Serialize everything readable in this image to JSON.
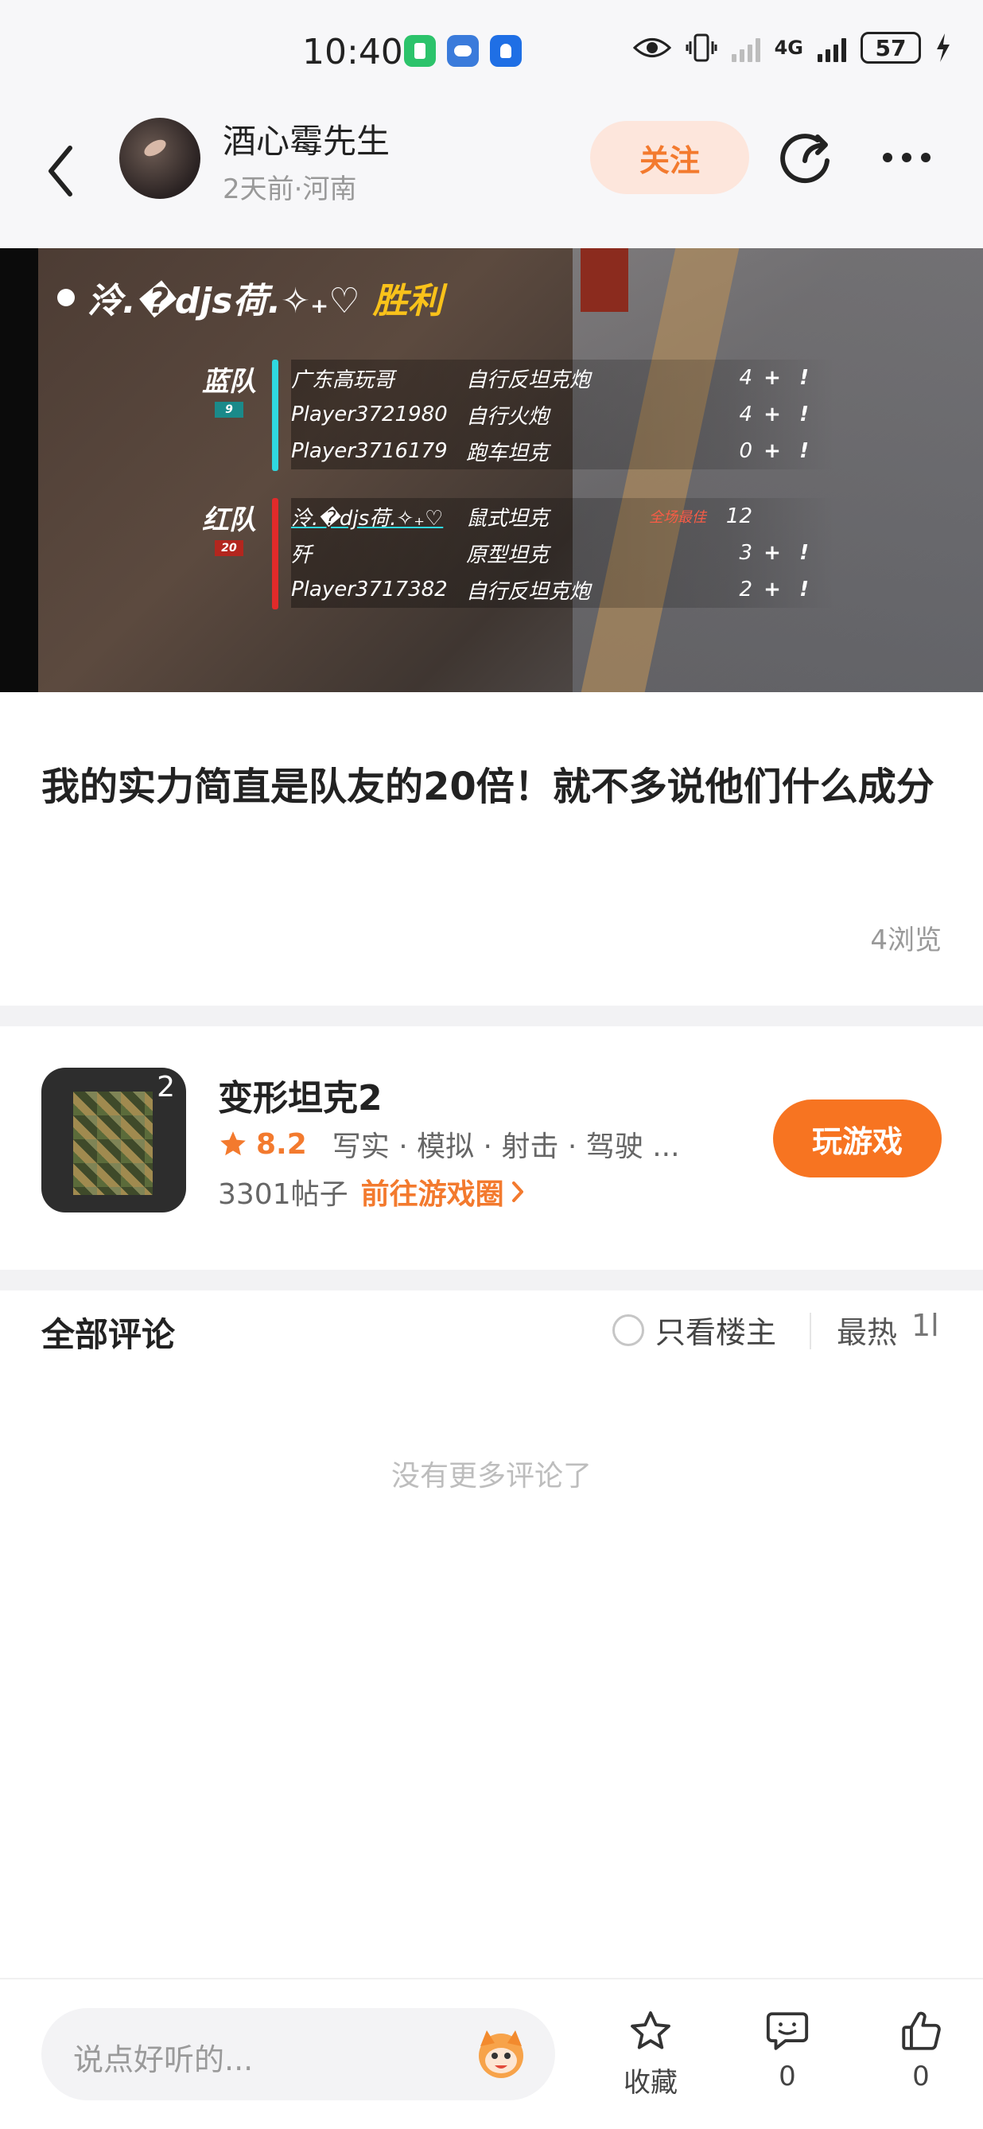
{
  "status_bar": {
    "time": "10:40",
    "network": "4G",
    "battery": "57"
  },
  "header": {
    "author_name": "酒心霉先生",
    "author_meta": "2天前·河南",
    "follow_label": "关注"
  },
  "game_screenshot": {
    "player_name": "泠.�djs荷.✧₊♡",
    "result": "胜利",
    "blue_team": {
      "label": "蓝队",
      "score": "9",
      "rows": [
        {
          "player": "广东高玩哥",
          "tank": "自行反坦克炮",
          "score": "4"
        },
        {
          "player": "Player3721980",
          "tank": "自行火炮",
          "score": "4"
        },
        {
          "player": "Player3716179",
          "tank": "跑车坦克",
          "score": "0"
        }
      ]
    },
    "red_team": {
      "label": "红队",
      "score": "20",
      "rows": [
        {
          "player": "泠.�djs荷.✧₊♡",
          "tank": "鼠式坦克",
          "best": "全场最佳",
          "score": "12"
        },
        {
          "player": "歼",
          "tank": "原型坦克",
          "score": "3"
        },
        {
          "player": "Player3717382",
          "tank": "自行反坦克炮",
          "score": "2"
        }
      ]
    }
  },
  "post": {
    "title": "我的实力简直是队友的20倍！就不多说他们什么成分",
    "views": "4浏览"
  },
  "game_card": {
    "name": "变形坦克2",
    "rating": "8.2",
    "tags": "写实 · 模拟 · 射击 · 驾驶 ...",
    "posts": "3301帖子",
    "goto_label": "前往游戏圈",
    "play_label": "玩游戏",
    "icon_number": "2"
  },
  "comments": {
    "title": "全部评论",
    "only_owner_label": "只看楼主",
    "sort_label": "最热",
    "sort_more": "1l",
    "empty_text": "没有更多评论了"
  },
  "bottom_bar": {
    "input_placeholder": "说点好听的...",
    "favorite_label": "收藏",
    "comment_count": "0",
    "like_count": "0"
  },
  "colors": {
    "accent": "#f77421",
    "follow_bg": "#fde6dc"
  }
}
